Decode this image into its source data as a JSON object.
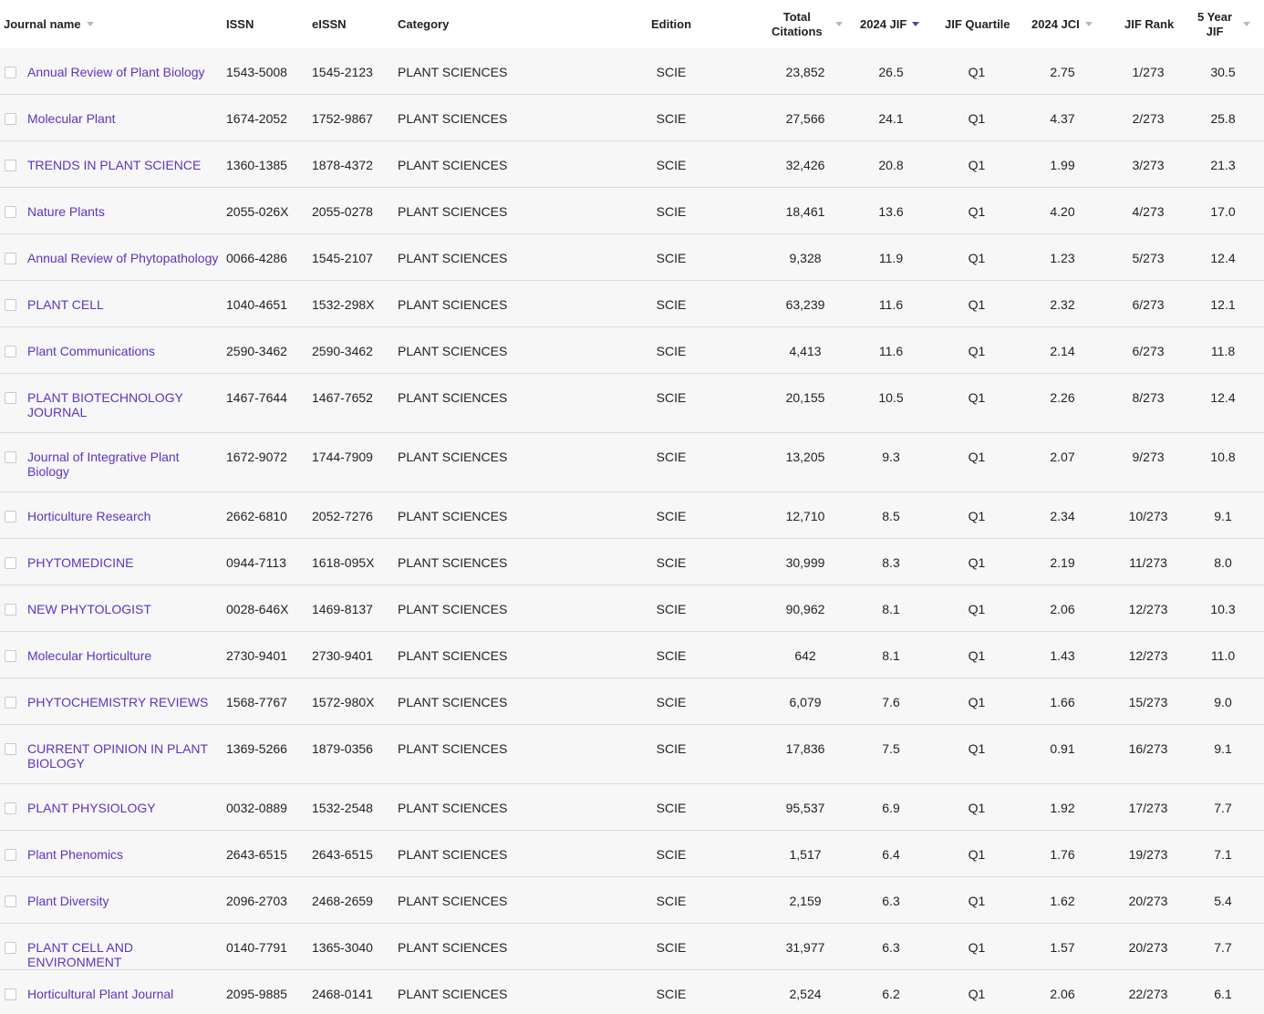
{
  "header": {
    "journal_name": "Journal name",
    "issn": "ISSN",
    "eissn": "eISSN",
    "category": "Category",
    "edition": "Edition",
    "total_citations_line1": "Total",
    "total_citations_line2": "Citations",
    "jif": "2024 JIF",
    "jif_quartile": "JIF Quartile",
    "jci": "2024 JCI",
    "jif_rank": "JIF Rank",
    "five_year_line1": "5 Year",
    "five_year_line2": "JIF"
  },
  "sort": {
    "active_column": "2024 JIF",
    "active_color": "#5e33bf",
    "inactive_color": "#b8b8b8"
  },
  "colors": {
    "link": "#5e33bf",
    "row_bg": "#f7f7f7",
    "header_bg": "#ffffff",
    "divider": "#dcdcdc"
  },
  "rows": [
    {
      "name": "Annual Review of Plant Biology",
      "issn": "1543-5008",
      "eissn": "1545-2123",
      "category": "PLANT SCIENCES",
      "edition": "SCIE",
      "citations": "23,852",
      "jif": "26.5",
      "quartile": "Q1",
      "jci": "2.75",
      "rank": "1/273",
      "five_year": "30.5"
    },
    {
      "name": "Molecular Plant",
      "issn": "1674-2052",
      "eissn": "1752-9867",
      "category": "PLANT SCIENCES",
      "edition": "SCIE",
      "citations": "27,566",
      "jif": "24.1",
      "quartile": "Q1",
      "jci": "4.37",
      "rank": "2/273",
      "five_year": "25.8"
    },
    {
      "name": "TRENDS IN PLANT SCIENCE",
      "issn": "1360-1385",
      "eissn": "1878-4372",
      "category": "PLANT SCIENCES",
      "edition": "SCIE",
      "citations": "32,426",
      "jif": "20.8",
      "quartile": "Q1",
      "jci": "1.99",
      "rank": "3/273",
      "five_year": "21.3"
    },
    {
      "name": "Nature Plants",
      "issn": "2055-026X",
      "eissn": "2055-0278",
      "category": "PLANT SCIENCES",
      "edition": "SCIE",
      "citations": "18,461",
      "jif": "13.6",
      "quartile": "Q1",
      "jci": "4.20",
      "rank": "4/273",
      "five_year": "17.0"
    },
    {
      "name": "Annual Review of Phytopathology",
      "issn": "0066-4286",
      "eissn": "1545-2107",
      "category": "PLANT SCIENCES",
      "edition": "SCIE",
      "citations": "9,328",
      "jif": "11.9",
      "quartile": "Q1",
      "jci": "1.23",
      "rank": "5/273",
      "five_year": "12.4"
    },
    {
      "name": "PLANT CELL",
      "issn": "1040-4651",
      "eissn": "1532-298X",
      "category": "PLANT SCIENCES",
      "edition": "SCIE",
      "citations": "63,239",
      "jif": "11.6",
      "quartile": "Q1",
      "jci": "2.32",
      "rank": "6/273",
      "five_year": "12.1"
    },
    {
      "name": "Plant Communications",
      "issn": "2590-3462",
      "eissn": "2590-3462",
      "category": "PLANT SCIENCES",
      "edition": "SCIE",
      "citations": "4,413",
      "jif": "11.6",
      "quartile": "Q1",
      "jci": "2.14",
      "rank": "6/273",
      "five_year": "11.8"
    },
    {
      "name": "PLANT BIOTECHNOLOGY JOURNAL",
      "issn": "1467-7644",
      "eissn": "1467-7652",
      "category": "PLANT SCIENCES",
      "edition": "SCIE",
      "citations": "20,155",
      "jif": "10.5",
      "quartile": "Q1",
      "jci": "2.26",
      "rank": "8/273",
      "five_year": "12.4"
    },
    {
      "name": "Journal of Integrative Plant Biology",
      "issn": "1672-9072",
      "eissn": "1744-7909",
      "category": "PLANT SCIENCES",
      "edition": "SCIE",
      "citations": "13,205",
      "jif": "9.3",
      "quartile": "Q1",
      "jci": "2.07",
      "rank": "9/273",
      "five_year": "10.8"
    },
    {
      "name": "Horticulture Research",
      "issn": "2662-6810",
      "eissn": "2052-7276",
      "category": "PLANT SCIENCES",
      "edition": "SCIE",
      "citations": "12,710",
      "jif": "8.5",
      "quartile": "Q1",
      "jci": "2.34",
      "rank": "10/273",
      "five_year": "9.1"
    },
    {
      "name": "PHYTOMEDICINE",
      "issn": "0944-7113",
      "eissn": "1618-095X",
      "category": "PLANT SCIENCES",
      "edition": "SCIE",
      "citations": "30,999",
      "jif": "8.3",
      "quartile": "Q1",
      "jci": "2.19",
      "rank": "11/273",
      "five_year": "8.0"
    },
    {
      "name": "NEW PHYTOLOGIST",
      "issn": "0028-646X",
      "eissn": "1469-8137",
      "category": "PLANT SCIENCES",
      "edition": "SCIE",
      "citations": "90,962",
      "jif": "8.1",
      "quartile": "Q1",
      "jci": "2.06",
      "rank": "12/273",
      "five_year": "10.3"
    },
    {
      "name": "Molecular Horticulture",
      "issn": "2730-9401",
      "eissn": "2730-9401",
      "category": "PLANT SCIENCES",
      "edition": "SCIE",
      "citations": "642",
      "jif": "8.1",
      "quartile": "Q1",
      "jci": "1.43",
      "rank": "12/273",
      "five_year": "11.0"
    },
    {
      "name": "PHYTOCHEMISTRY REVIEWS",
      "issn": "1568-7767",
      "eissn": "1572-980X",
      "category": "PLANT SCIENCES",
      "edition": "SCIE",
      "citations": "6,079",
      "jif": "7.6",
      "quartile": "Q1",
      "jci": "1.66",
      "rank": "15/273",
      "five_year": "9.0"
    },
    {
      "name": "CURRENT OPINION IN PLANT BIOLOGY",
      "issn": "1369-5266",
      "eissn": "1879-0356",
      "category": "PLANT SCIENCES",
      "edition": "SCIE",
      "citations": "17,836",
      "jif": "7.5",
      "quartile": "Q1",
      "jci": "0.91",
      "rank": "16/273",
      "five_year": "9.1"
    },
    {
      "name": "PLANT PHYSIOLOGY",
      "issn": "0032-0889",
      "eissn": "1532-2548",
      "category": "PLANT SCIENCES",
      "edition": "SCIE",
      "citations": "95,537",
      "jif": "6.9",
      "quartile": "Q1",
      "jci": "1.92",
      "rank": "17/273",
      "five_year": "7.7"
    },
    {
      "name": "Plant Phenomics",
      "issn": "2643-6515",
      "eissn": "2643-6515",
      "category": "PLANT SCIENCES",
      "edition": "SCIE",
      "citations": "1,517",
      "jif": "6.4",
      "quartile": "Q1",
      "jci": "1.76",
      "rank": "19/273",
      "five_year": "7.1"
    },
    {
      "name": "Plant Diversity",
      "issn": "2096-2703",
      "eissn": "2468-2659",
      "category": "PLANT SCIENCES",
      "edition": "SCIE",
      "citations": "2,159",
      "jif": "6.3",
      "quartile": "Q1",
      "jci": "1.62",
      "rank": "20/273",
      "five_year": "5.4"
    },
    {
      "name": "PLANT CELL AND ENVIRONMENT",
      "issn": "0140-7791",
      "eissn": "1365-3040",
      "category": "PLANT SCIENCES",
      "edition": "SCIE",
      "citations": "31,977",
      "jif": "6.3",
      "quartile": "Q1",
      "jci": "1.57",
      "rank": "20/273",
      "five_year": "7.7"
    },
    {
      "name": "Horticultural Plant Journal",
      "issn": "2095-9885",
      "eissn": "2468-0141",
      "category": "PLANT SCIENCES",
      "edition": "SCIE",
      "citations": "2,524",
      "jif": "6.2",
      "quartile": "Q1",
      "jci": "2.06",
      "rank": "22/273",
      "five_year": "6.1"
    }
  ]
}
